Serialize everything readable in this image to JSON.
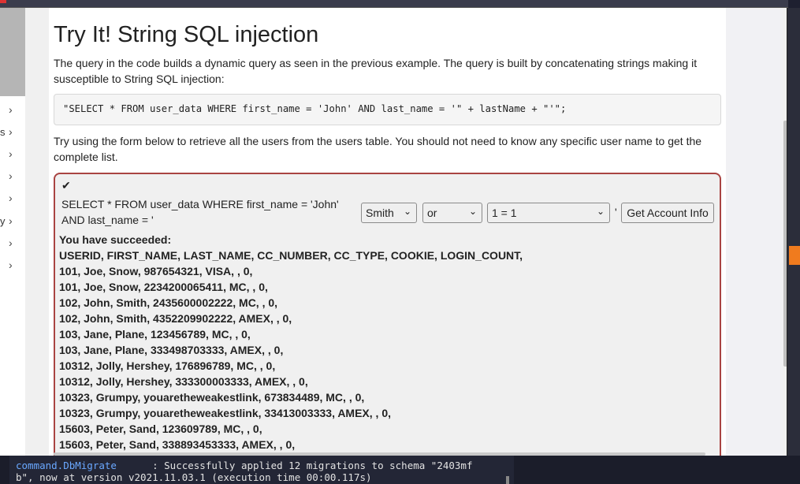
{
  "sidebar": {
    "items": [
      {
        "fragment": "",
        "chevron": "›"
      },
      {
        "fragment": "s",
        "chevron": "›"
      },
      {
        "fragment": "",
        "chevron": "›"
      },
      {
        "fragment": "",
        "chevron": "›"
      },
      {
        "fragment": "",
        "chevron": "›"
      },
      {
        "fragment": "y",
        "chevron": "›"
      },
      {
        "fragment": "",
        "chevron": "›"
      },
      {
        "fragment": "",
        "chevron": "›"
      }
    ]
  },
  "lesson": {
    "title": "Try It! String SQL injection",
    "intro": "The query in the code builds a dynamic query as seen in the previous example. The query is built by concatenating strings making it susceptible to String SQL injection:",
    "code": "\"SELECT * FROM user_data WHERE first_name = 'John' AND last_name = '\" + lastName + \"'\";",
    "instructions": "Try using the form below to retrieve all the users from the users table. You should not need to know any specific user name to get the complete list."
  },
  "form": {
    "check_icon": "✔",
    "query_label": "SELECT * FROM user_data WHERE first_name = 'John' AND last_name = '",
    "select_name": "Smith",
    "select_operator": "or",
    "select_condition": "1 = 1",
    "quote": "'",
    "submit_label": "Get Account Info",
    "dropdown_arrow": "⌄"
  },
  "result": {
    "heading": "You have succeeded:",
    "lines": [
      "USERID, FIRST_NAME, LAST_NAME, CC_NUMBER, CC_TYPE, COOKIE, LOGIN_COUNT,",
      "101, Joe, Snow, 987654321, VISA, , 0,",
      "101, Joe, Snow, 2234200065411, MC, , 0,",
      "102, John, Smith, 2435600002222, MC, , 0,",
      "102, John, Smith, 4352209902222, AMEX, , 0,",
      "103, Jane, Plane, 123456789, MC, , 0,",
      "103, Jane, Plane, 333498703333, AMEX, , 0,",
      "10312, Jolly, Hershey, 176896789, MC, , 0,",
      "10312, Jolly, Hershey, 333300003333, AMEX, , 0,",
      "10323, Grumpy, youaretheweakestlink, 673834489, MC, , 0,",
      "10323, Grumpy, youaretheweakestlink, 33413003333, AMEX, , 0,",
      "15603, Peter, Sand, 123609789, MC, , 0,",
      "15603, Peter, Sand, 338893453333, AMEX, , 0,"
    ]
  },
  "terminal": {
    "command": "command.DbMigrate",
    "line1_rest": "      : Successfully applied 12 migrations to schema \"2403mf",
    "line2": "b\", now at version v2021.11.03.1 (execution time 00:00.117s)"
  },
  "colors": {
    "accent_border": "#a94442",
    "terminal_bg": "#1b1d2a",
    "orange_tab": "#f07b1e"
  }
}
